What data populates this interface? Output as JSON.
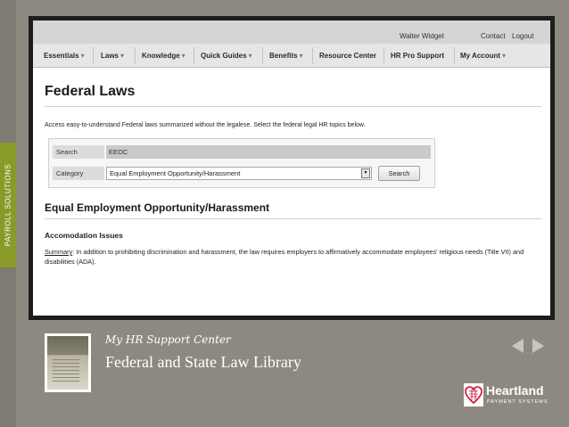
{
  "sidebar": {
    "label": "PAYROLL SOLUTIONS"
  },
  "topbar": {
    "user": "Walter Widget",
    "contact": "Contact",
    "logout": "Logout"
  },
  "nav": {
    "items": [
      {
        "label": "Essentials",
        "caret": "▾"
      },
      {
        "label": "Laws",
        "caret": "▾"
      },
      {
        "label": "Knowledge",
        "caret": "▾"
      },
      {
        "label": "Quick Guides",
        "caret": "▾"
      },
      {
        "label": "Benefits",
        "caret": "▾"
      },
      {
        "label": "Resource Center",
        "caret": ""
      },
      {
        "label": "HR Pro Support",
        "caret": ""
      },
      {
        "label": "My Account",
        "caret": "▾"
      }
    ]
  },
  "page": {
    "title": "Federal Laws",
    "intro": "Access easy-to-understand Federal laws summarized without the legalese. Select the federal legal HR topics below."
  },
  "search_form": {
    "search_label": "Search",
    "search_value": "EEOC",
    "category_label": "Category",
    "category_value": "Equal Employment Opportunity/Harassment",
    "dropdown_glyph": "▾",
    "button_label": "Search"
  },
  "result": {
    "section_title": "Equal Employment Opportunity/Harassment",
    "subsection_title": "Accomodation Issues",
    "summary_label": "Summary",
    "summary_text": ":  In addition to prohibiting discrimination and harassment, the law requires employers to affirmatively accommodate employees' religious needs (Title VII) and disabilities (ADA)."
  },
  "footer": {
    "subtitle": "My HR Support Center",
    "title": "Federal and State Law Library"
  },
  "logo": {
    "name": "Heartland",
    "tagline": "PAYMENT SYSTEMS"
  },
  "colors": {
    "sidebar_accent": "#8a9a2a",
    "background": "#8c8a80",
    "logo_red": "#c8102e"
  },
  "icons": {
    "prev": "arrow-left-icon",
    "next": "arrow-right-icon",
    "logo": "heartland-logo-icon"
  }
}
